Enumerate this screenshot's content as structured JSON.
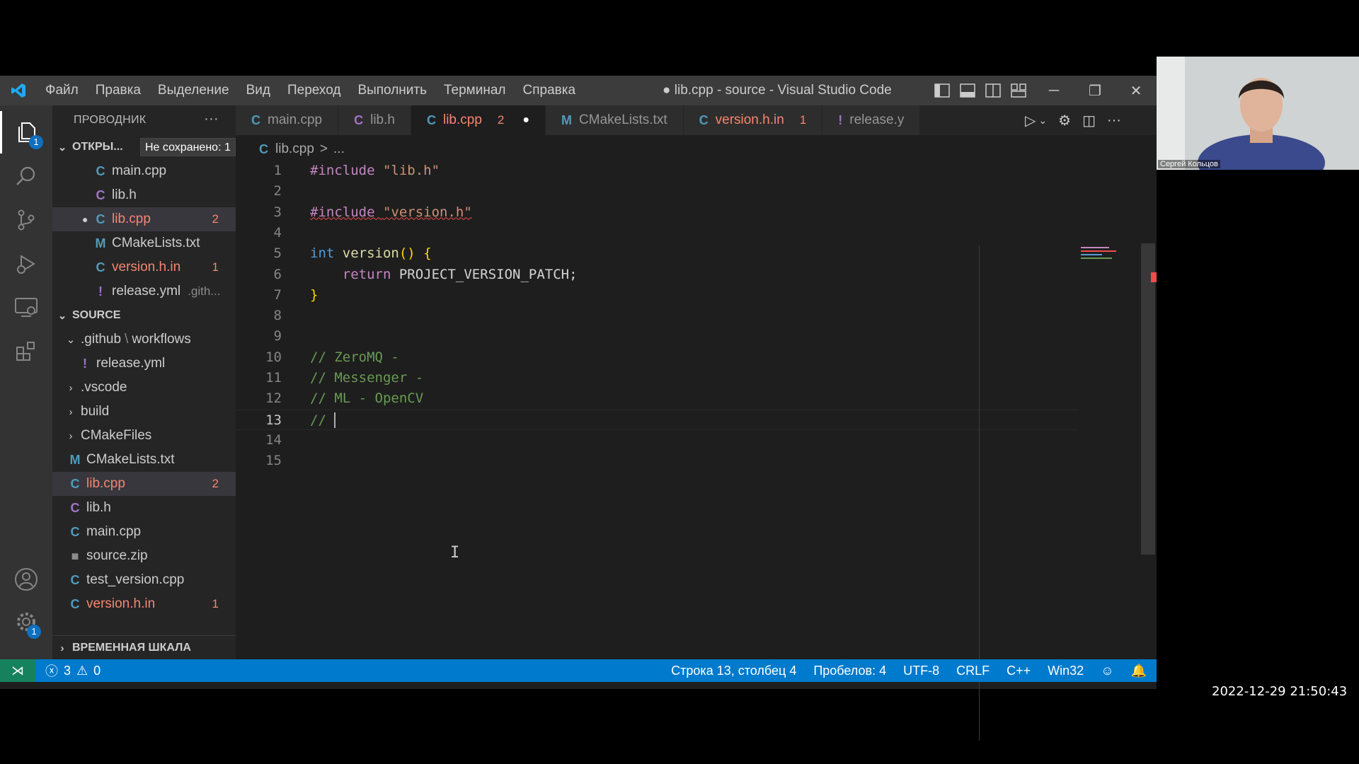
{
  "window": {
    "title": "● lib.cpp - source - Visual Studio Code",
    "menu": [
      "Файл",
      "Правка",
      "Выделение",
      "Вид",
      "Переход",
      "Выполнить",
      "Терминал",
      "Справка"
    ]
  },
  "activity": {
    "explorer_badge": "1",
    "settings_badge": "1",
    "items": [
      "explorer-icon",
      "search-icon",
      "source-control-icon",
      "run-debug-icon",
      "remote-explorer-icon",
      "extensions-icon",
      "account-icon",
      "settings-gear-icon"
    ]
  },
  "sidebar": {
    "header": "ПРОВОДНИК",
    "more": "···",
    "open_editors": {
      "title": "ОТКРЫ...",
      "unsaved_tooltip": "Не сохранено: 1",
      "items": [
        {
          "icon": "C",
          "label": "main.cpp",
          "count": "",
          "dirty": false,
          "error": false,
          "extra": ""
        },
        {
          "icon": "C",
          "label": "lib.h",
          "count": "",
          "dirty": false,
          "error": false,
          "extra": ""
        },
        {
          "icon": "C",
          "label": "lib.cpp",
          "count": "2",
          "dirty": true,
          "error": true,
          "extra": ""
        },
        {
          "icon": "M",
          "label": "CMakeLists.txt",
          "count": "",
          "dirty": false,
          "error": false,
          "extra": ""
        },
        {
          "icon": "C",
          "label": "version.h.in",
          "count": "1",
          "dirty": false,
          "error": true,
          "extra": ""
        },
        {
          "icon": "!",
          "label": "release.yml",
          "count": "",
          "dirty": false,
          "error": false,
          "extra": ".gith..."
        }
      ]
    },
    "source": {
      "title": "SOURCE",
      "folder_github": ".github",
      "folder_sep": "\\",
      "folder_workflows": "workflows",
      "release": "release.yml",
      "vscode": ".vscode",
      "build": "build",
      "cmakefiles": "CMakeFiles",
      "files": [
        {
          "icon": "M",
          "label": "CMakeLists.txt",
          "count": ""
        },
        {
          "icon": "C",
          "label": "lib.cpp",
          "count": "2"
        },
        {
          "icon": "C",
          "label": "lib.h",
          "count": ""
        },
        {
          "icon": "C",
          "label": "main.cpp",
          "count": ""
        },
        {
          "icon": "■",
          "label": "source.zip",
          "count": ""
        },
        {
          "icon": "C",
          "label": "test_version.cpp",
          "count": ""
        },
        {
          "icon": "C",
          "label": "version.h.in",
          "count": "1"
        }
      ]
    },
    "timeline": "ВРЕМЕННАЯ ШКАЛА"
  },
  "tabs": [
    {
      "icon": "C",
      "label": "main.cpp",
      "count": "",
      "active": false
    },
    {
      "icon": "C",
      "label": "lib.h",
      "count": "",
      "active": false
    },
    {
      "icon": "C",
      "label": "lib.cpp",
      "count": "2",
      "active": true,
      "dirty": "●"
    },
    {
      "icon": "M",
      "label": "CMakeLists.txt",
      "count": "",
      "active": false
    },
    {
      "icon": "C",
      "label": "version.h.in",
      "count": "1",
      "active": false
    },
    {
      "icon": "!",
      "label": "release.y",
      "count": "",
      "active": false
    }
  ],
  "breadcrumb": {
    "file": "lib.cpp",
    "sep": ">",
    "more": "..."
  },
  "editor": {
    "current_line": "13",
    "lines": [
      {
        "n": "1",
        "parts": [
          [
            "k-inc",
            "#include"
          ],
          [
            "",
            " "
          ],
          [
            "k-str",
            "\"lib.h\""
          ]
        ]
      },
      {
        "n": "2",
        "parts": []
      },
      {
        "n": "3",
        "parts": [
          [
            "k-inc squiggle",
            "#include"
          ],
          [
            "squiggle",
            " "
          ],
          [
            "k-str squiggle",
            "\"version.h\""
          ]
        ]
      },
      {
        "n": "4",
        "parts": []
      },
      {
        "n": "5",
        "parts": [
          [
            "k-int",
            "int"
          ],
          [
            "",
            " "
          ],
          [
            "k-fn",
            "version"
          ],
          [
            "k-brace",
            "()"
          ],
          [
            "",
            " "
          ],
          [
            "k-brace",
            "{"
          ]
        ]
      },
      {
        "n": "6",
        "parts": [
          [
            "",
            "    "
          ],
          [
            "k-ret",
            "return"
          ],
          [
            "",
            " "
          ],
          [
            "k-mac",
            "PROJECT_VERSION_PATCH;"
          ]
        ]
      },
      {
        "n": "7",
        "parts": [
          [
            "k-brace",
            "}"
          ]
        ]
      },
      {
        "n": "8",
        "parts": []
      },
      {
        "n": "9",
        "parts": []
      },
      {
        "n": "10",
        "parts": [
          [
            "k-cmt",
            "// ZeroMQ - "
          ]
        ]
      },
      {
        "n": "11",
        "parts": [
          [
            "k-cmt",
            "// Messenger - "
          ]
        ]
      },
      {
        "n": "12",
        "parts": [
          [
            "k-cmt",
            "// ML - OpenCV "
          ]
        ]
      },
      {
        "n": "13",
        "parts": [
          [
            "k-cmt",
            "// "
          ]
        ],
        "cursor": true
      },
      {
        "n": "14",
        "parts": []
      },
      {
        "n": "15",
        "parts": []
      }
    ]
  },
  "status": {
    "errors": "3",
    "warnings": "0",
    "position": "Строка 13, столбец 4",
    "spaces": "Пробелов: 4",
    "encoding": "UTF-8",
    "eol": "CRLF",
    "language": "C++",
    "platform": "Win32"
  },
  "overlay": {
    "webcam_name": "Сергей Кольцов",
    "timestamp": "2022-12-29  21:50:43"
  },
  "colors": {
    "accent": "#007acc",
    "error": "#f48771",
    "remote": "#16825d"
  }
}
